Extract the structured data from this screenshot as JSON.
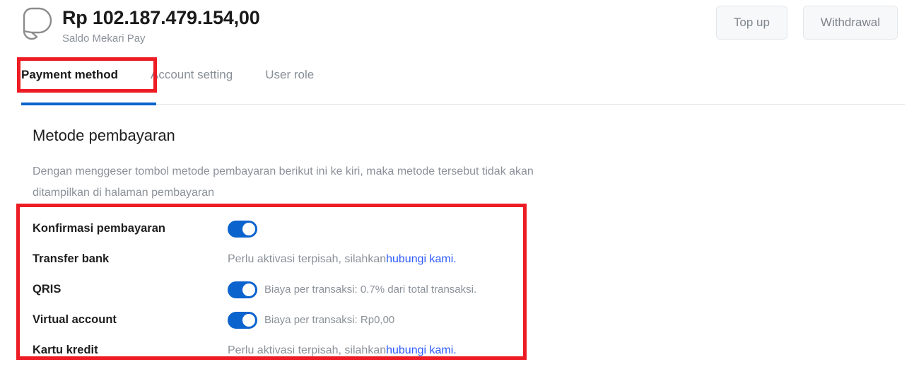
{
  "header": {
    "logo_icon": "mekari-pay-logo-icon",
    "balance_amount": "Rp 102.187.479.154,00",
    "balance_caption": "Saldo Mekari Pay",
    "actions": [
      {
        "label": "Top up",
        "name": "top-up-button"
      },
      {
        "label": "Withdrawal",
        "name": "withdrawal-button"
      }
    ]
  },
  "tabs": [
    {
      "label": "Payment method",
      "active": true
    },
    {
      "label": "Account setting",
      "active": false
    },
    {
      "label": "User role",
      "active": false
    }
  ],
  "main": {
    "section_title": "Metode pembayaran",
    "section_description": "Dengan menggeser tombol metode pembayaran berikut ini ke kiri, maka metode tersebut tidak akan ditampilkan di halaman pembayaran"
  },
  "payment_methods": [
    {
      "label": "Konfirmasi pembayaran",
      "type": "toggle",
      "enabled": true,
      "note": ""
    },
    {
      "label": "Transfer bank",
      "type": "text",
      "note_prefix": "Perlu aktivasi terpisah, silahkan ",
      "link_text": "hubungi kami",
      "note_suffix": "."
    },
    {
      "label": "QRIS",
      "type": "toggle",
      "enabled": true,
      "note": "Biaya per transaksi: 0.7% dari total transaksi."
    },
    {
      "label": "Virtual account",
      "type": "toggle",
      "enabled": true,
      "note": "Biaya per transaksi: Rp0,00"
    },
    {
      "label": "Kartu kredit",
      "type": "text",
      "note_prefix": "Perlu aktivasi terpisah, silahkan ",
      "link_text": "hubungi kami",
      "note_suffix": "."
    }
  ],
  "colors": {
    "accent_blue": "#0b63ce",
    "link_blue": "#2d5bff",
    "annotation_red": "#ed1c24",
    "muted_gray": "#8b9199",
    "text_dark": "#1e1e1e"
  },
  "annotations": [
    {
      "name": "annotation-box-payment-method-tab"
    },
    {
      "name": "annotation-box-payment-methods-table"
    }
  ]
}
